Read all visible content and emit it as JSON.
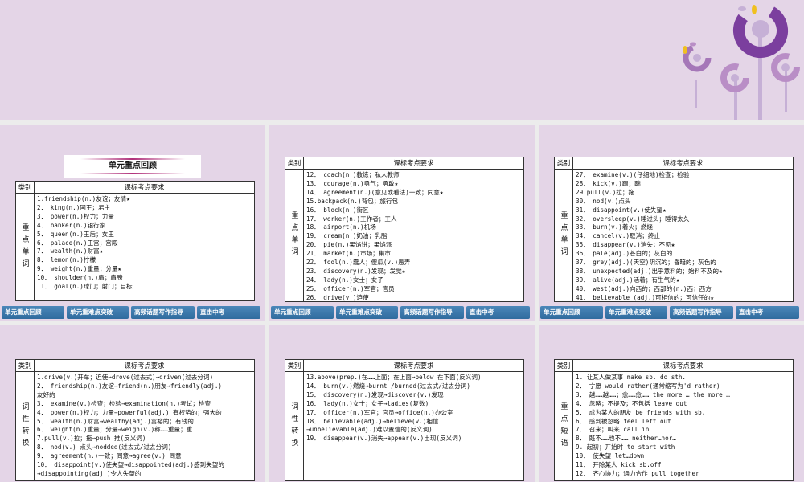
{
  "nav": [
    "单元重点回顾",
    "单元重难点突破",
    "高频话题写作指导",
    "直击中考"
  ],
  "colors": {
    "background": "#e4d5e7",
    "nav": "#2f6b9e",
    "deco": "#7b3f9e"
  },
  "header": {
    "category": "类别",
    "requirements": "课标考点要求"
  },
  "slides": [
    {
      "banner": "单元重点回顾",
      "category": "重点单词",
      "rows": [
        "1.friendship(n.)友谊；友情★",
        "2． king(n.)国王；君主",
        "3． power(n.)权力；力量",
        "4． banker(n.)银行家",
        "5． queen(n.)王后；女王",
        "6． palace(n.)王宫；宫殿",
        "7． wealth(n.)财富★",
        "8． lemon(n.)柠檬",
        "9． weight(n.)重量；分量★",
        "10． shoulder(n.)肩；肩膀",
        "11． goal(n.)球门；射门；目标"
      ]
    },
    {
      "category": "重点单词",
      "rows": [
        "12． coach(n.)教练；私人教师",
        "13． courage(n.)勇气；勇敢★",
        "14． agreement(n.)(意见或看法)一致；同意★",
        "15.backpack(n.)背包；旅行包",
        "16． block(n.)街区",
        "17． worker(n.)工作者；工人",
        "18． airport(n.)机场",
        "19． cream(n.)奶油；乳脂",
        "20． pie(n.)果馅饼；果馅派",
        "21． market(n.)市场；集市",
        "22． fool(n.)蠢人；傻瓜(v.)愚弄",
        "23． discovery(n.)发现；发觉★",
        "24． lady(n.)女士；女子",
        "25． officer(n.)军官；官员",
        "26． drive(v.)迫使"
      ]
    },
    {
      "category": "重点单词",
      "rows": [
        "27． examine(v.)(仔细地)检查；检验",
        "28． kick(v.)踢；踹",
        "29.pull(v.)拉；拖",
        "30． nod(v.)点头",
        "31． disappoint(v.)使失望★",
        "32． oversleep(v.)睡过头；睡得太久",
        "33． burn(v.)着火；燃烧",
        "34． cancel(v.)取消；终止",
        "35． disappear(v.)消失；不见★",
        "36． pale(adj.)苍白的；灰白的",
        "37． grey(adj.)(天空)阴沉的；昏暗的；灰色的",
        "38． unexpected(adj.)出乎意料的；始料不及的★",
        "39． alive(adj.)活着；有生气的★",
        "40． west(adj.)向西的；西部的(n.)西；西方",
        "41． believable (adj.)可相信的；可信任的★"
      ]
    },
    {
      "category": "词性转换",
      "rows": [
        "1.drive(v.)开车；迫使→drove(过去式)→driven(过去分词)",
        "2． friendship(n.)友谊→friend(n.)朋友→friendly(adj.)",
        "友好的",
        "3． examine(v.)检查；检验→examination(n.)考试；检查",
        "4． power(n.)权力；力量→powerful(adj.) 有权势的；强大的",
        "5． wealth(n.)财富→wealthy(adj.)富裕的；有钱的",
        "6． weight(n.)重量；分量→weigh(v.)称……重量；重",
        "7.pull(v.)拉；拖→push 推(反义词)",
        "8． nod(v.) 点头→nodded(过去式/过去分词)",
        "9． agreement(n.)一致；同意→agree(v.) 同意",
        "10． disappoint(v.)使失望→disappointed(adj.)感到失望的",
        "→disappointing(adj.)令人失望的"
      ]
    },
    {
      "category": "词性转换",
      "rows": [
        "13.above(prep.)在……上面；在上面→below 在下面(反义词)",
        "14． burn(v.)燃烧→burnt /burned(过去式/过去分词)",
        "15． discovery(n.)发现→discover(v.)发现",
        "16． lady(n.)女士；女子→ladies(复数)",
        "17． officer(n.)军官；官员→office(n.)办公室",
        "18． believable(adj.)→believe(v.)相信",
        "→unbelievable(adj.)难以置信的(反义词)",
        "19． disappear(v.)消失→appear(v.)出现(反义词)"
      ]
    },
    {
      "category": "重点短语",
      "rows": [
        "1. 让某人做某事 make sb. do sth.",
        "2． 宁愿 would rather(通常缩写为'd rather)",
        "3． 越……越……；愈……愈…… the more … the more …",
        "4． 忽略；不提及；不包括 leave out",
        "5． 成为某人的朋友 be friends with sb.",
        "6． 感到被忽略 feel left out",
        "7． 召来；叫来 call in",
        "8． 既不……也不…… neither…nor…",
        "9. 起初；开始时 to start with",
        "10． 使失望 let…down",
        "11． 开除某人 kick sb.off",
        "12． 齐心协力；通力合作 pull together"
      ]
    }
  ]
}
